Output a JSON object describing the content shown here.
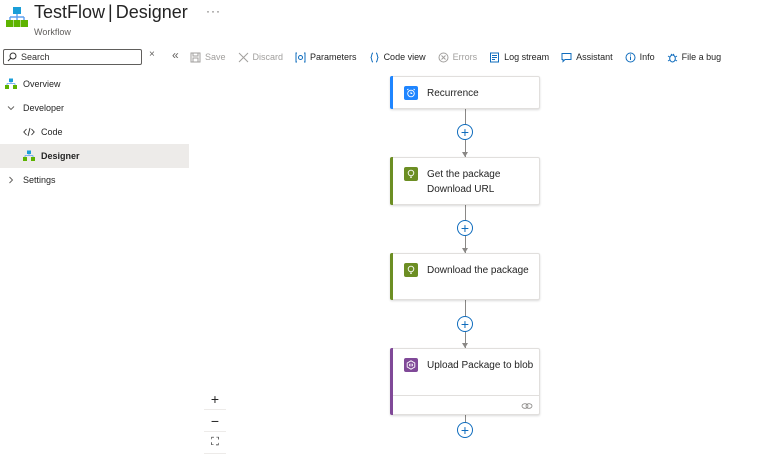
{
  "header": {
    "app_name": "TestFlow",
    "separator": "|",
    "page": "Designer",
    "subtitle": "Workflow",
    "more": "···"
  },
  "sidebar": {
    "search_placeholder": "Search",
    "clear": "×",
    "collapse": "«",
    "items": [
      {
        "label": "Overview",
        "icon": "workflow-icon"
      },
      {
        "label": "Developer",
        "icon": "chevron-down-icon",
        "expanded": true
      },
      {
        "label": "Code",
        "icon": "code-icon"
      },
      {
        "label": "Designer",
        "icon": "workflow-icon",
        "selected": true
      },
      {
        "label": "Settings",
        "icon": "chevron-right-icon",
        "expanded": false
      }
    ]
  },
  "toolbar": {
    "save": "Save",
    "discard": "Discard",
    "parameters": "Parameters",
    "code_view": "Code view",
    "errors": "Errors",
    "log_stream": "Log stream",
    "assistant": "Assistant",
    "info": "Info",
    "file_bug": "File a bug"
  },
  "designer": {
    "steps": [
      {
        "label": "Recurrence",
        "icon": "alarm-clock-icon",
        "color": "#1f85ff"
      },
      {
        "label": "Get the package Download URL",
        "icon": "lightbulb-icon",
        "color": "#6c8e23"
      },
      {
        "label": "Download the package",
        "icon": "lightbulb-icon",
        "color": "#6c8e23"
      },
      {
        "label": "Upload Package to blob",
        "icon": "storage-blob-icon",
        "color": "#804998"
      }
    ],
    "zoom": {
      "in": "+",
      "out": "−",
      "fit": "⛶"
    }
  }
}
